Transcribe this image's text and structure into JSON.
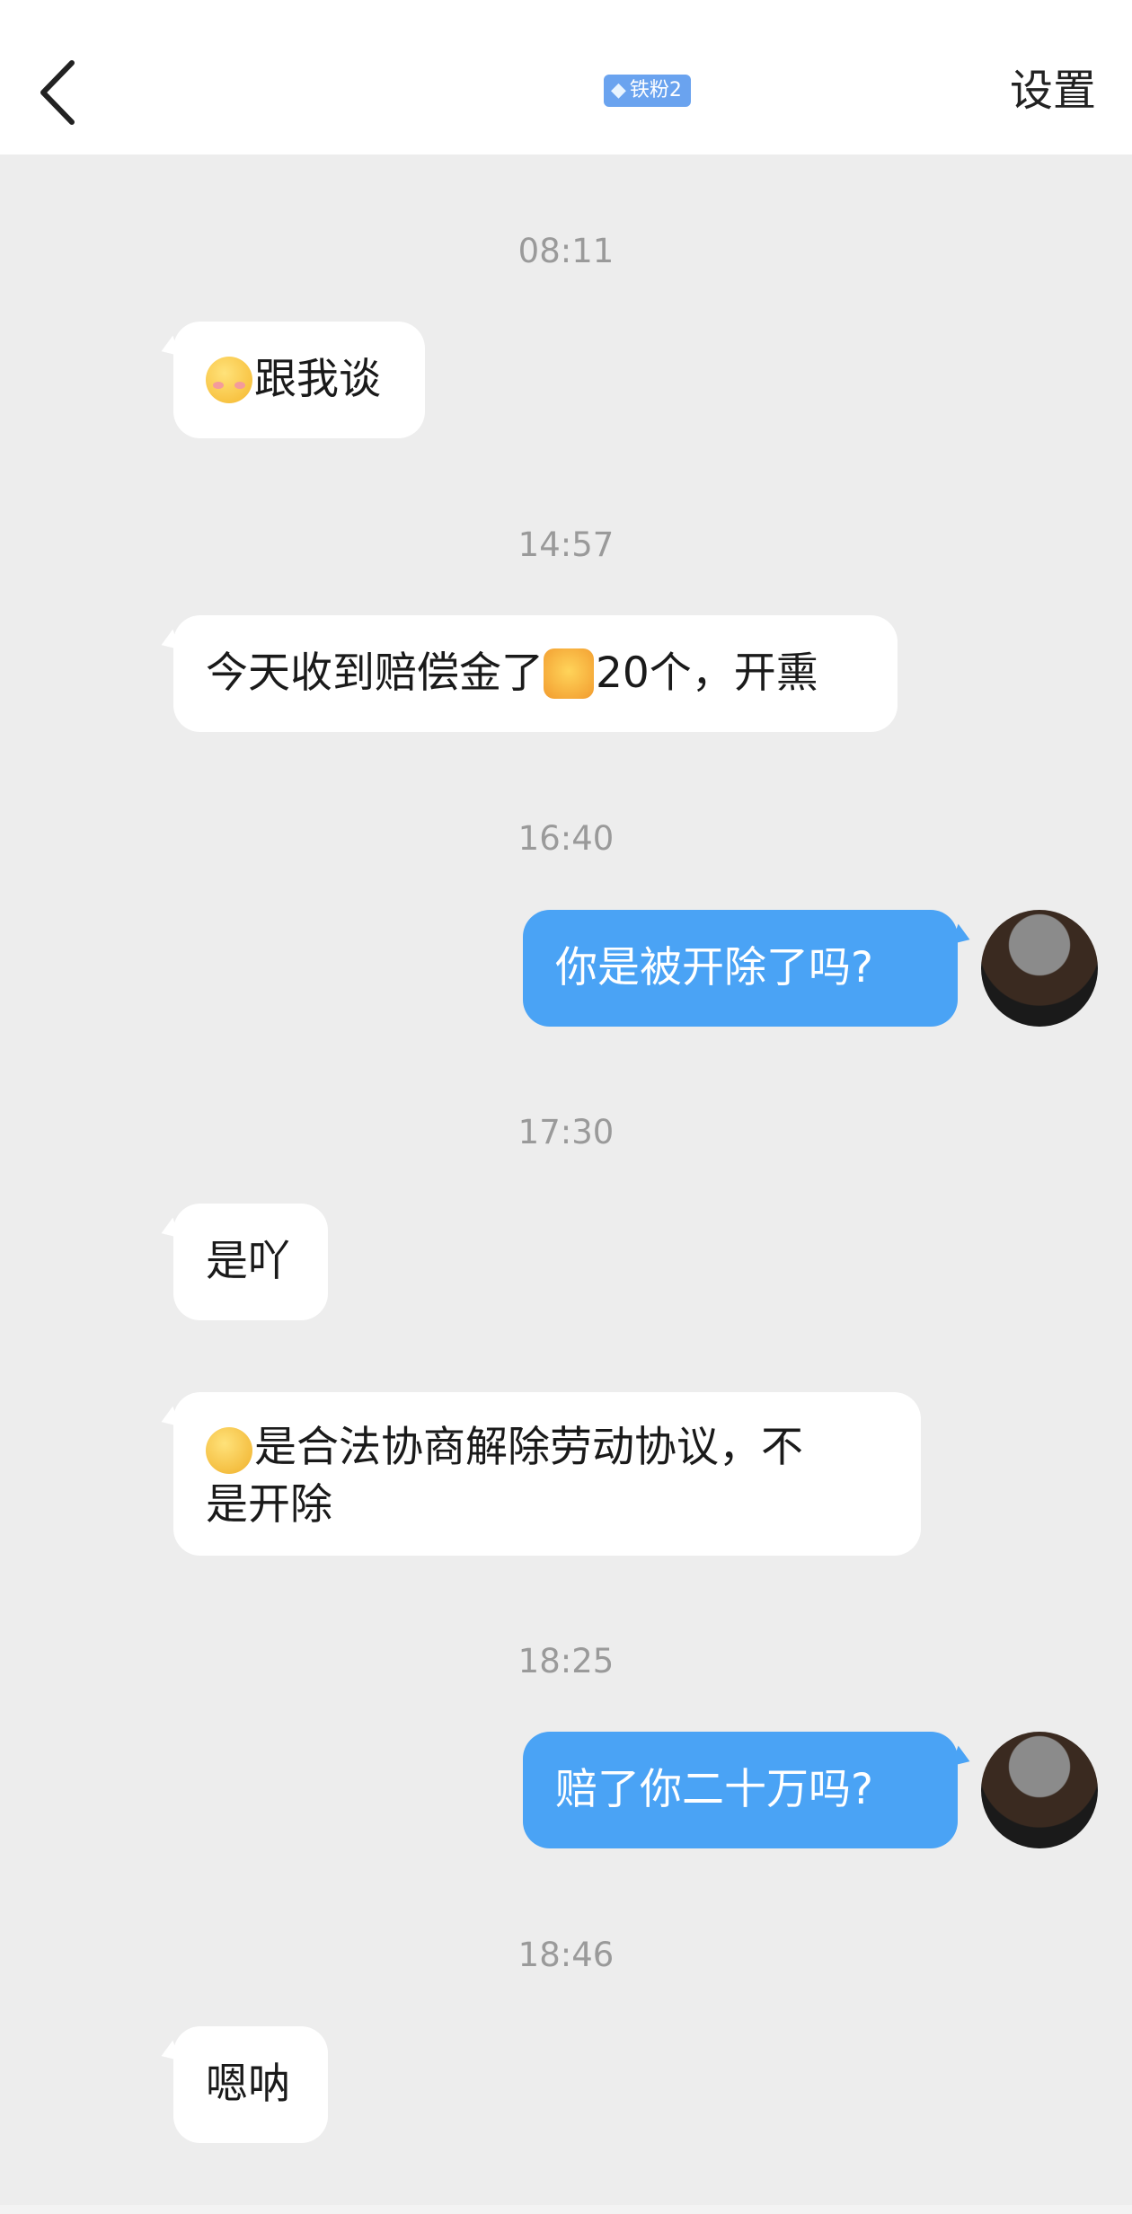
{
  "header": {
    "back_icon": "chevron-left-icon",
    "fan_badge": "铁粉2",
    "settings_label": "设置"
  },
  "messages": [
    {
      "type": "time",
      "text": "08:11"
    },
    {
      "type": "in",
      "emoji": "smile-blush-emoji",
      "text": "跟我谈"
    },
    {
      "type": "time",
      "text": "14:57"
    },
    {
      "type": "in",
      "text_before": "今天收到赔偿金了",
      "emoji": "cat-emoji",
      "text_after": "20个，开熏"
    },
    {
      "type": "time",
      "text": "16:40"
    },
    {
      "type": "out",
      "text": "你是被开除了吗?"
    },
    {
      "type": "time",
      "text": "17:30"
    },
    {
      "type": "in",
      "text": "是吖"
    },
    {
      "type": "in",
      "emoji": "thinking-emoji",
      "line1": "是合法协商解除劳动协议，不",
      "line2": "是开除"
    },
    {
      "type": "time",
      "text": "18:25"
    },
    {
      "type": "out",
      "text": "赔了你二十万吗?"
    },
    {
      "type": "time",
      "text": "18:46"
    },
    {
      "type": "in",
      "text": "嗯呐"
    }
  ],
  "colors": {
    "background": "#ededed",
    "outgoing_bubble": "#4aa3f5",
    "incoming_bubble": "#ffffff",
    "badge": "#6aa3ef"
  }
}
